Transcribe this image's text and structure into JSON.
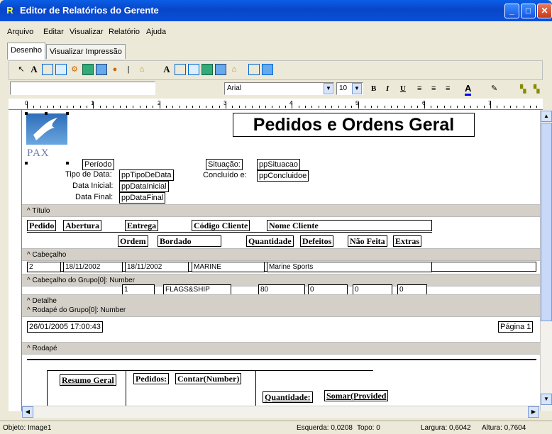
{
  "window": {
    "title": "Editor de Relatórios do Gerente",
    "icon": "R"
  },
  "menu": [
    "Arquivo",
    "Editar",
    "Visualizar",
    "Relatório",
    "Ajuda"
  ],
  "tabs": [
    "Desenho",
    "Visualizar Impressão"
  ],
  "format": {
    "font": "Arial",
    "size": "10",
    "bold": "B",
    "italic": "I",
    "underline": "U"
  },
  "ruler": [
    "0",
    "1",
    "2",
    "3",
    "4",
    "5",
    "6",
    "7"
  ],
  "report": {
    "title": "Pedidos e Ordens Geral",
    "logo_text": "PAX",
    "header_labels": {
      "periodo": "Período",
      "tipo_data": "Tipo de Data:",
      "data_inicial": "Data Inicial:",
      "data_final": "Data Final:",
      "situacao": "Situação:",
      "concluido": "Concluído e:"
    },
    "header_fields": {
      "tipo_data": "ppTipoDeData",
      "data_inicial": "ppDataInicial",
      "data_final": "ppDataFinal",
      "situacao": "ppSituacao",
      "concluido": "ppConcluidoe"
    },
    "bands": {
      "titulo": "^ Título",
      "cabecalho": "^ Cabeçalho",
      "cab_grupo": "^ Cabeçalho do Grupo[0]: Number",
      "detalhe": "^ Detalhe",
      "rod_grupo": "^ Rodapé do Grupo[0]: Number",
      "rodape": "^ Rodapé"
    },
    "columns_row1": [
      "Pedido",
      "Abertura",
      "Entrega",
      "Código Cliente",
      "Nome Cliente"
    ],
    "columns_row2": [
      "Ordem",
      "Bordado",
      "Quantidade",
      "Defeitos",
      "Não Feita",
      "Extras"
    ],
    "group_row": [
      "2",
      "18/11/2002",
      "18/11/2002",
      "MARINE",
      "Marine Sports"
    ],
    "detail_row": [
      "1",
      "FLAGS&SHIP",
      "80",
      "0",
      "0",
      "0"
    ],
    "footer_date": "26/01/2005 17:00:43",
    "footer_page": "Página 1",
    "summary": {
      "resumo": "Resumo Geral",
      "pedidos": "Pedidos:",
      "contar": "Contar(Number)",
      "quantidade": "Quantidade:",
      "somar": "Somar(Provided"
    }
  },
  "status": {
    "objeto": "Objeto: Image1",
    "esquerda": "Esquerda: 0,0208",
    "topo": "Topo: 0",
    "largura": "Largura: 0,6042",
    "altura": "Altura: 0,7604"
  },
  "colors": {
    "titlebar": "#0a4fd8",
    "band": "#d4d0c8"
  }
}
